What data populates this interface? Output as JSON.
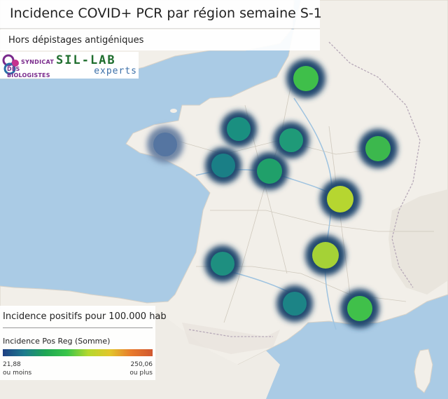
{
  "title": "Incidence COVID+ PCR par région semaine S-1",
  "subtitle": "Hors dépistages antigéniques",
  "logos": {
    "sdb_line1": "SYNDICAT",
    "sdb_line2": "DES BIOLOGISTES",
    "sil_line1": "SIL-LAB",
    "sil_line2": "experts"
  },
  "legend": {
    "title": "Incidence positifs pour 100.000 hab",
    "series": "Incidence Pos Reg (Somme)",
    "min_value": "21,88",
    "max_value": "250,06",
    "min_note": "ou moins",
    "max_note": "ou plus"
  },
  "colors": {
    "sea": "#aacbe5",
    "land": "#f2efe9",
    "low": "#1f3f83",
    "mid": "#39c54a",
    "high": "#d05830"
  },
  "heat_points": [
    {
      "value": 150,
      "color": "#3fbf4a"
    },
    {
      "value": 90,
      "color": "#1a8f80"
    },
    {
      "value": 95,
      "color": "#1f9a78"
    },
    {
      "value": 140,
      "color": "#3cb84d"
    },
    {
      "value": 30,
      "color": "#4a6ea0"
    },
    {
      "value": 85,
      "color": "#1a7f86"
    },
    {
      "value": 110,
      "color": "#20a06a"
    },
    {
      "value": 200,
      "color": "#b6d630"
    },
    {
      "value": 190,
      "color": "#a5d236"
    },
    {
      "value": 95,
      "color": "#1e8f80"
    },
    {
      "value": 88,
      "color": "#1c8486"
    },
    {
      "value": 150,
      "color": "#40c04a"
    }
  ]
}
